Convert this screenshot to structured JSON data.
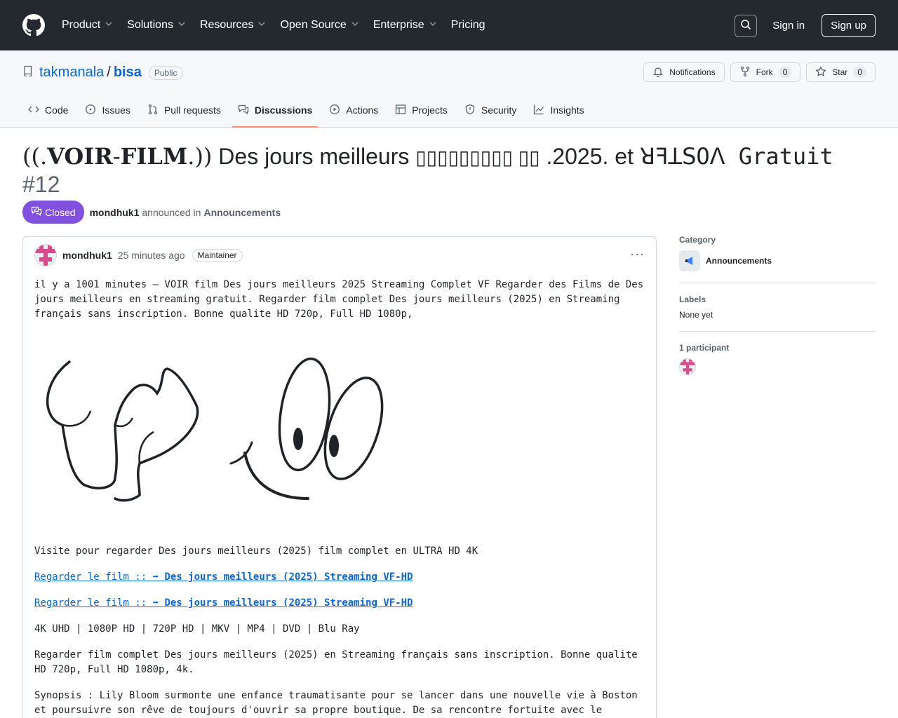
{
  "topnav": {
    "items": [
      {
        "label": "Product",
        "has_menu": true
      },
      {
        "label": "Solutions",
        "has_menu": true
      },
      {
        "label": "Resources",
        "has_menu": true
      },
      {
        "label": "Open Source",
        "has_menu": true
      },
      {
        "label": "Enterprise",
        "has_menu": true
      },
      {
        "label": "Pricing",
        "has_menu": false
      }
    ],
    "signin": "Sign in",
    "signup": "Sign up",
    "icons": {
      "logo": "github-mark-icon",
      "search": "search-icon"
    }
  },
  "repo": {
    "owner": "takmanala",
    "separator": "/",
    "name": "bisa",
    "visibility": "Public",
    "notifications_label": "Notifications",
    "fork_label": "Fork",
    "fork_count": "0",
    "star_label": "Star",
    "star_count": "0"
  },
  "tabs": [
    {
      "label": "Code",
      "icon": "code-icon",
      "active": false
    },
    {
      "label": "Issues",
      "icon": "issue-icon",
      "active": false
    },
    {
      "label": "Pull requests",
      "icon": "pull-request-icon",
      "active": false
    },
    {
      "label": "Discussions",
      "icon": "discussion-icon",
      "active": true
    },
    {
      "label": "Actions",
      "icon": "play-icon",
      "active": false
    },
    {
      "label": "Projects",
      "icon": "table-icon",
      "active": false
    },
    {
      "label": "Security",
      "icon": "shield-icon",
      "active": false
    },
    {
      "label": "Insights",
      "icon": "graph-icon",
      "active": false
    }
  ],
  "discussion": {
    "title_prefix": "((.",
    "title_voir": "VOIR",
    "title_dash": "-",
    "title_film": "FILM",
    "title_close": ".))",
    "title_main": "Des jours meilleurs",
    "title_boxes": "▯▯▯▯▯▯▯▯▯ ▯▯",
    "title_year": ".2025. et",
    "title_vostfr": "ꓤꟻꓕꓢOꓥ Gratuit",
    "number": "#12",
    "status": "Closed",
    "author": "mondhuk1",
    "announced_text": "announced in",
    "category": "Announcements"
  },
  "comment": {
    "author": "mondhuk1",
    "time": "25 minutes ago",
    "role": "Maintainer",
    "menu": "···",
    "paragraph1": "il y a 1001 minutes — VOIR film Des jours meilleurs 2025 Streaming Complet VF Regarder des Films de Des jours meilleurs en streaming gratuit. Regarder film complet Des jours meilleurs (2025) en Streaming français sans inscription. Bonne qualite HD 720p, Full HD 1080p,",
    "visite": "Visite pour regarder Des jours meilleurs (2025) film complet en ULTRA HD 4K",
    "link_prefix": "Regarder le film :: ➡",
    "link_bold": "Des jours meilleurs (2025) Streaming VF-HD",
    "formats": "4K UHD | 1080P HD | 720P HD | MKV | MP4 | DVD | Blu Ray",
    "paragraph_regarder": "Regarder film complet Des jours meilleurs (2025) en Streaming français sans inscription. Bonne qualite HD 720p, Full HD 1080p, 4k.",
    "synopsis": "Synopsis : Lily Bloom surmonte une enfance traumatisante pour se lancer dans une nouvelle vie à Boston et poursuivre son rêve de toujours d'ouvrir sa propre boutique. De sa rencontre fortuite avec le charmant"
  },
  "sidebar": {
    "category_heading": "Category",
    "category_value": "Announcements",
    "category_icon": "megaphone-icon",
    "labels_heading": "Labels",
    "labels_value": "None yet",
    "participants_heading": "1 participant"
  },
  "colors": {
    "header_bg": "#24292f",
    "link": "#0969da",
    "closed_badge": "#8250df",
    "active_tab_underline": "#fd8c73",
    "avatar_pink": "#d94a8c"
  }
}
